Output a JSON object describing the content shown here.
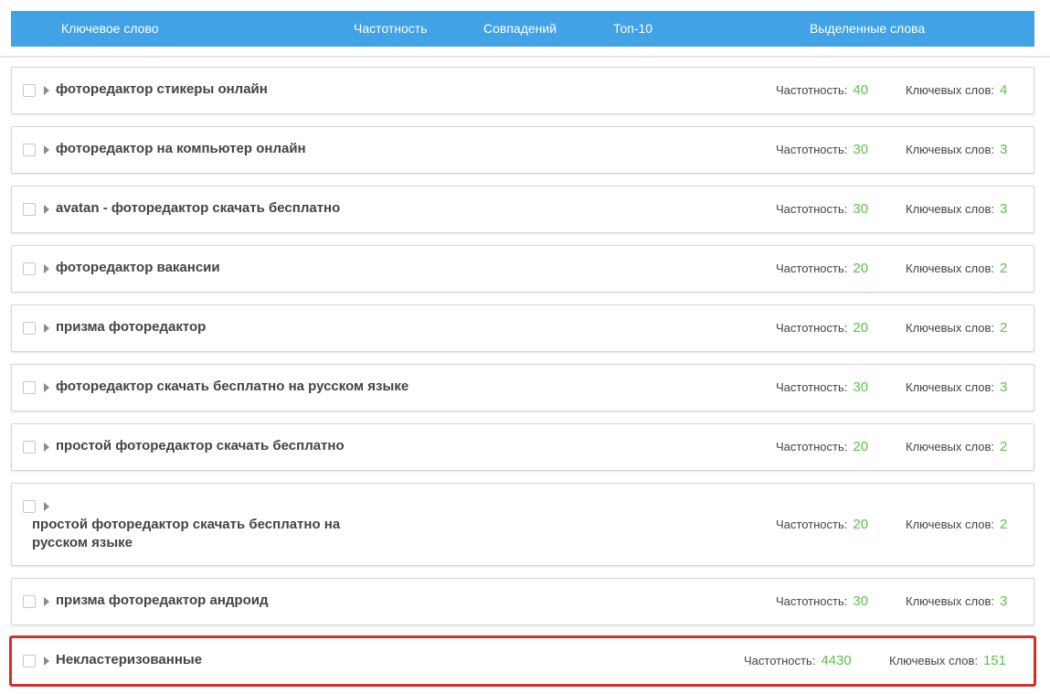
{
  "header": {
    "keyword": "Ключевое слово",
    "frequency": "Частотность",
    "matches": "Совпадений",
    "top10": "Топ-10",
    "selected_words": "Выделенные слова"
  },
  "labels": {
    "frequency": "Частотность:",
    "keywords": "Ключевых слов:"
  },
  "colors": {
    "header_bg": "#41a2e6",
    "value_green": "#5cc24a",
    "highlight_border": "#d32f2f"
  },
  "clusters": [
    {
      "keyword": "фоторедактор стикеры онлайн",
      "frequency": "40",
      "keywords": "4"
    },
    {
      "keyword": "фоторедактор на компьютер онлайн",
      "frequency": "30",
      "keywords": "3"
    },
    {
      "keyword": "avatan - фоторедактор скачать бесплатно",
      "frequency": "30",
      "keywords": "3"
    },
    {
      "keyword": "фоторедактор вакансии",
      "frequency": "20",
      "keywords": "2"
    },
    {
      "keyword": "призма фоторедактор",
      "frequency": "20",
      "keywords": "2"
    },
    {
      "keyword": "фоторедактор скачать бесплатно на русском языке",
      "frequency": "30",
      "keywords": "3"
    },
    {
      "keyword": "простой фоторедактор скачать бесплатно",
      "frequency": "20",
      "keywords": "2"
    },
    {
      "keyword": "простой фоторедактор скачать бесплатно на русском языке",
      "frequency": "20",
      "keywords": "2"
    },
    {
      "keyword": "призма фоторедактор андроид",
      "frequency": "30",
      "keywords": "3"
    },
    {
      "keyword": "Некластеризованные",
      "frequency": "4430",
      "keywords": "151"
    }
  ]
}
